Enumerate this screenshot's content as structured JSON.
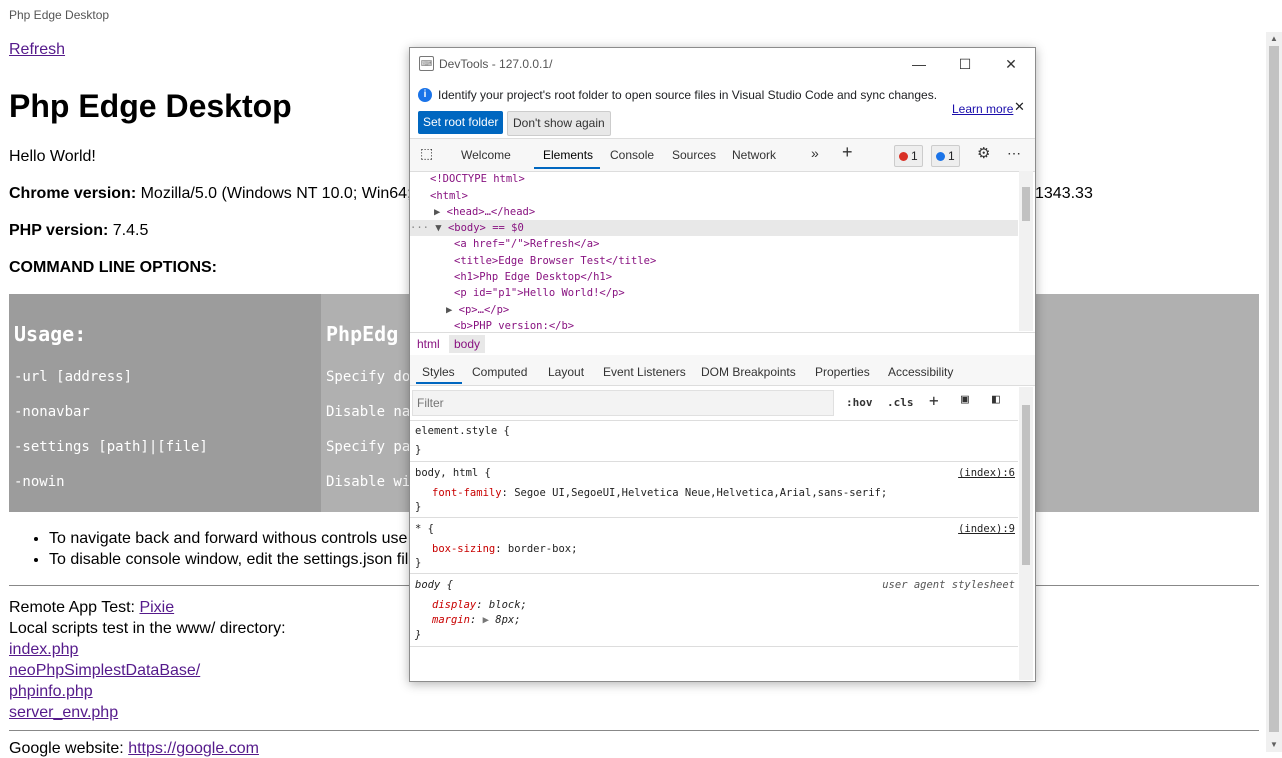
{
  "window": {
    "title": "Php Edge Desktop"
  },
  "page": {
    "refresh_link": "Refresh",
    "heading": "Php Edge Desktop",
    "hello": "Hello World!",
    "chrome_label": "Chrome version:",
    "chrome_value": "Mozilla/5.0 (Windows NT 10.0; Win64; x",
    "chrome_value_tail": "1343.33",
    "php_label": "PHP version:",
    "php_value": "7.4.5",
    "cmd_heading": "COMMAND LINE OPTIONS:",
    "usage": {
      "header_left": "Usage:",
      "header_right": "PhpEdg",
      "rows": [
        {
          "option": "-url [address]",
          "desc": "Specify do"
        },
        {
          "option": "-nonavbar",
          "desc": "Disable na"
        },
        {
          "option": "-settings [path]|[file]",
          "desc": "Specify pa"
        },
        {
          "option": "-nowin",
          "desc": "Disable wi"
        }
      ]
    },
    "notes": [
      "To navigate back and forward withous controls use",
      "To disable console window, edit the settings.json fil"
    ],
    "remote_label": "Remote App Test:",
    "remote_link": "Pixie",
    "local_label": "Local scripts test in the www/ directory:",
    "local_links": [
      "index.php",
      "neoPhpSimplestDataBase/",
      "phpinfo.php",
      "server_env.php"
    ],
    "google_label": "Google website:",
    "google_link": "https://google.com"
  },
  "devtools": {
    "title": "DevTools - 127.0.0.1/",
    "infobar": {
      "text": "Identify your project's root folder to open source files in Visual Studio Code and sync changes.",
      "learn_more": "Learn more",
      "set_root": "Set root folder",
      "dont_show": "Don't show again"
    },
    "tabs": [
      "Welcome",
      "Elements",
      "Console",
      "Sources",
      "Network"
    ],
    "active_tab": "Elements",
    "error_count": "1",
    "issue_count": "1",
    "dom": [
      "<!DOCTYPE html>",
      "<html>",
      "<head>…</head>",
      "<body> == $0",
      "<a href=\"/\">Refresh</a>",
      "<title>Edge Browser Test</title>",
      "<h1>Php Edge Desktop</h1>",
      "<p id=\"p1\">Hello World!</p>",
      "<p>…</p>",
      "<b>PHP version:</b>"
    ],
    "breadcrumbs": [
      "html",
      "body"
    ],
    "subtabs": [
      "Styles",
      "Computed",
      "Layout",
      "Event Listeners",
      "DOM Breakpoints",
      "Properties",
      "Accessibility"
    ],
    "filter_placeholder": "Filter",
    "hov": ":hov",
    "cls": ".cls",
    "rules": [
      {
        "selector": "element.style {",
        "source": ""
      },
      {
        "selector": "body, html {",
        "source": "(index):6",
        "decl_prop": "font-family",
        "decl_val": "Segoe UI,SegoeUI,Helvetica Neue,Helvetica,Arial,sans-serif;"
      },
      {
        "selector": "* {",
        "source": "(index):9",
        "decl_prop": "box-sizing",
        "decl_val": "border-box;"
      },
      {
        "selector": "body {",
        "source": "user agent stylesheet",
        "decl1_prop": "display",
        "decl1_val": "block;",
        "decl2_prop": "margin",
        "decl2_val": "8px;"
      }
    ]
  }
}
